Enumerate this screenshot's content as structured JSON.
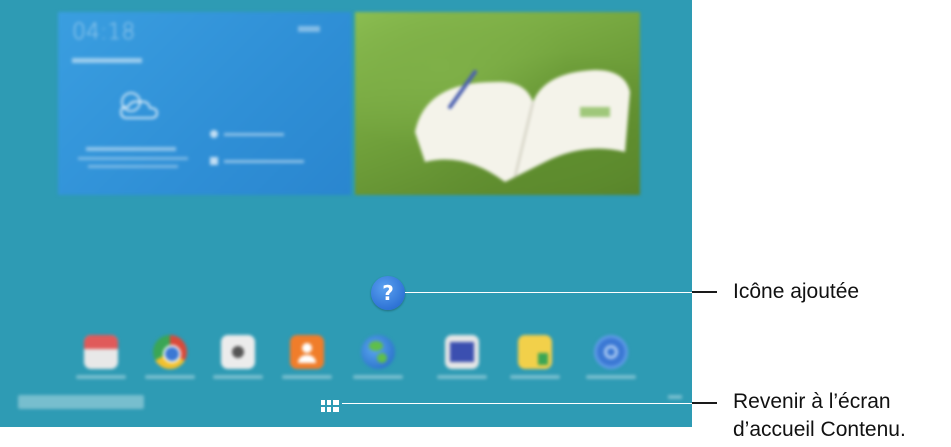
{
  "callouts": {
    "added_icon_label": "Icône ajoutée",
    "return_label_line1": "Revenir à l’écran",
    "return_label_line2": "d’accueil Contenu."
  },
  "screen": {
    "background_color": "#2e9bb4",
    "added_icon_glyph": "?",
    "weather_widget": {
      "time": "04:18"
    },
    "dock_apps": [
      {
        "name": "calendar-app-icon",
        "color": "#e05a5a"
      },
      {
        "name": "chrome-app-icon",
        "color": "#d94a3a"
      },
      {
        "name": "camera-app-icon",
        "color": "#e8e8e8"
      },
      {
        "name": "contacts-app-icon",
        "color": "#f07d2a"
      },
      {
        "name": "internet-app-icon",
        "color": "#2a78d0"
      },
      {
        "name": "gallery-app-icon",
        "color": "#3b4fb0"
      },
      {
        "name": "memo-app-icon",
        "color": "#f2d04a"
      },
      {
        "name": "settings-app-icon",
        "color": "#3b78d4"
      }
    ]
  }
}
